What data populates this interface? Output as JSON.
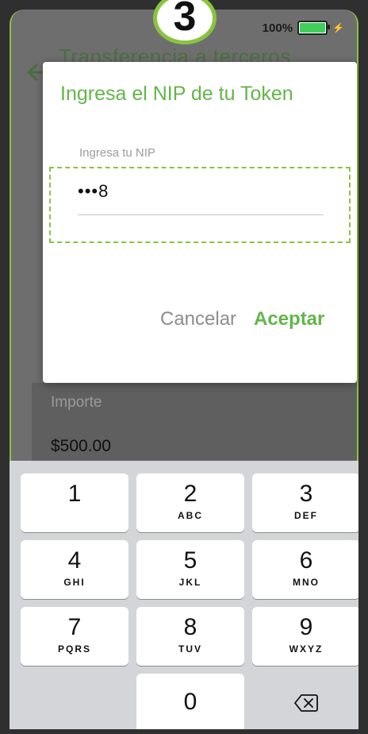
{
  "status": {
    "battery": "100%"
  },
  "background": {
    "title": "Transferencia a terceros",
    "amount_label": "Importe",
    "amount": "$500.00"
  },
  "step": "3",
  "dialog": {
    "title": "Ingresa el NIP de tu Token",
    "field_label": "Ingresa tu NIP",
    "field_value": "•••8",
    "cancel": "Cancelar",
    "accept": "Aceptar"
  },
  "keypad": {
    "keys": [
      {
        "num": "1",
        "letters": ""
      },
      {
        "num": "2",
        "letters": "ABC"
      },
      {
        "num": "3",
        "letters": "DEF"
      },
      {
        "num": "4",
        "letters": "GHI"
      },
      {
        "num": "5",
        "letters": "JKL"
      },
      {
        "num": "6",
        "letters": "MNO"
      },
      {
        "num": "7",
        "letters": "PQRS"
      },
      {
        "num": "8",
        "letters": "TUV"
      },
      {
        "num": "9",
        "letters": "WXYZ"
      },
      {
        "num": "0",
        "letters": ""
      }
    ],
    "delete_icon": "backspace-icon"
  },
  "colors": {
    "accent": "#63b54a",
    "highlight": "#8ac43f"
  }
}
